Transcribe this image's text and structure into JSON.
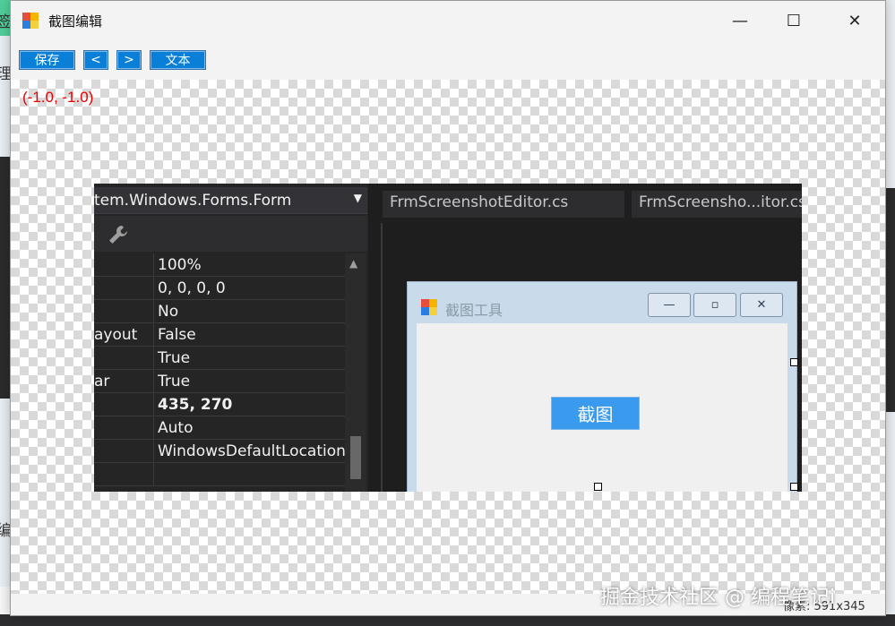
{
  "window": {
    "title": "截图编辑",
    "controls": {
      "minimize": "—",
      "maximize": "☐",
      "close": "✕"
    }
  },
  "toolbar": {
    "save_label": "保存",
    "prev_label": "<",
    "next_label": ">",
    "text_label": "文本"
  },
  "canvas": {
    "coords": "(-1.0, -1.0)"
  },
  "screenshot": {
    "properties": {
      "type_dropdown": "tem.Windows.Forms.Form",
      "rows": [
        {
          "name": "",
          "value": "100%",
          "bold": false
        },
        {
          "name": "",
          "value": "0, 0, 0, 0",
          "bold": false
        },
        {
          "name": "",
          "value": "No",
          "bold": false
        },
        {
          "name": "ayout",
          "value": "False",
          "bold": false
        },
        {
          "name": "",
          "value": "True",
          "bold": false
        },
        {
          "name": "ar",
          "value": "True",
          "bold": false
        },
        {
          "name": "",
          "value": "435, 270",
          "bold": true
        },
        {
          "name": "",
          "value": "Auto",
          "bold": false
        },
        {
          "name": "",
          "value": "WindowsDefaultLocation",
          "bold": false
        },
        {
          "name": "",
          "value": "",
          "bold": false
        }
      ]
    },
    "tabs": [
      {
        "label": "FrmScreenshotEditor.cs"
      },
      {
        "label": "FrmScreensho...itor.cs"
      }
    ],
    "designer_form": {
      "title": "截图工具",
      "min": "—",
      "max": "▫",
      "close": "✕",
      "capture_button": "截图"
    }
  },
  "watermark": "掘金技术社区 @ 编程笔记i",
  "status": "像素: 591x345",
  "background": {
    "left_fragment_1": "签",
    "left_fragment_2": "理",
    "left_fragment_3": "编"
  },
  "colors": {
    "toolbar_button": "#0a7fd8",
    "coords_text": "#e60000",
    "capture_button": "#3a9aee",
    "ide_background": "#1e1e1e"
  },
  "icons": {
    "app": "app-icon",
    "wrench": "wrench-icon",
    "form": "form-icon"
  }
}
